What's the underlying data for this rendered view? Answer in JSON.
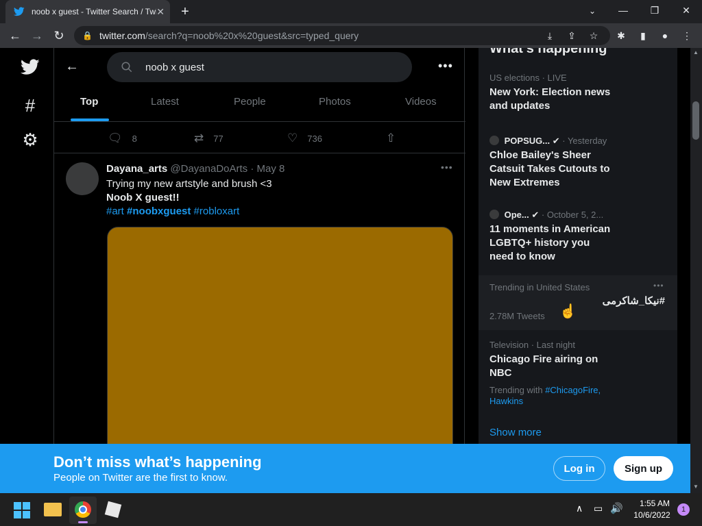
{
  "browser": {
    "tab_title": "noob x guest - Twitter Search / Twitter",
    "url_host": "twitter.com",
    "url_path": "/search?q=noob%20x%20guest&src=typed_query",
    "minimize": "—",
    "maximize": "❐",
    "close": "✕"
  },
  "search": {
    "query": "noob x guest"
  },
  "tabs": [
    {
      "label": "Top",
      "active": true
    },
    {
      "label": "Latest"
    },
    {
      "label": "People"
    },
    {
      "label": "Photos"
    },
    {
      "label": "Videos"
    }
  ],
  "prev_tweet_actions": {
    "replies": "8",
    "retweets": "77",
    "likes": "736"
  },
  "tweet": {
    "name": "Dayana_arts",
    "handle": "@DayanaDoArts",
    "sep": "·",
    "date": "May 8",
    "line1": "Trying my new artstyle and brush <3",
    "line2": "Noob X guest!!",
    "tag1": "#art",
    "tag2": "#noobxguest",
    "tag3": "#robloxart",
    "media_color": "#9b6a00"
  },
  "sidebar": {
    "header": "What’s happening",
    "trends": [
      {
        "meta": "US elections · LIVE",
        "title": "New York: Election news and updates"
      },
      {
        "source": "POPSUG...",
        "meta": "· Yesterday",
        "title": "Chloe Bailey's Sheer Catsuit Takes Cutouts to New Extremes"
      },
      {
        "source": "Ope...",
        "meta": "· October 5, 2...",
        "title": "11 moments in American LGBTQ+ history you need to know"
      },
      {
        "meta": "Trending in United States",
        "title": "#نیکا_شاکرمی",
        "count": "2.78M Tweets"
      },
      {
        "meta": "Television · Last night",
        "title": "Chicago Fire airing on NBC",
        "with_label": "Trending with",
        "with_tag1": "#ChicagoFire,",
        "with_tag2": "Hawkins"
      }
    ],
    "show_more": "Show more"
  },
  "banner": {
    "heading": "Don’t miss what’s happening",
    "sub": "People on Twitter are the first to know.",
    "login": "Log in",
    "signup": "Sign up"
  },
  "taskbar": {
    "time": "1:55 AM",
    "date": "10/6/2022",
    "notif": "1"
  }
}
